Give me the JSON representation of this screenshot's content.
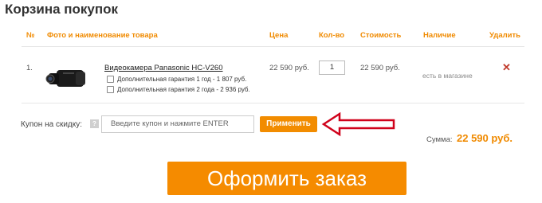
{
  "page": {
    "title": "Корзина покупок"
  },
  "table": {
    "headers": {
      "num": "№",
      "product": "Фото и наименование товара",
      "price": "Цена",
      "qty": "Кол-во",
      "cost": "Стоимость",
      "availability": "Наличие",
      "delete": "Удалить"
    },
    "rows": [
      {
        "num": "1.",
        "name": "Видеокамера Panasonic HC-V260",
        "options": [
          "Дополнительная гарантия 1 год - 1 807 руб.",
          "Дополнительная гарантия 2 года - 2 936 руб."
        ],
        "price": "22 590 руб.",
        "qty": "1",
        "cost": "22 590 руб.",
        "availability": "есть в магазине",
        "delete_icon": "close-icon"
      }
    ]
  },
  "coupon": {
    "label": "Купон на скидку:",
    "help": "?",
    "placeholder": "Введите купон и нажмите ENTER",
    "apply_label": "Применить"
  },
  "total": {
    "label": "Сумма:",
    "value": "22 590 руб."
  },
  "checkout": {
    "label": "Оформить заказ"
  },
  "colors": {
    "accent": "#f28c00",
    "arrow": "#d0021b",
    "delete": "#c0392b"
  }
}
